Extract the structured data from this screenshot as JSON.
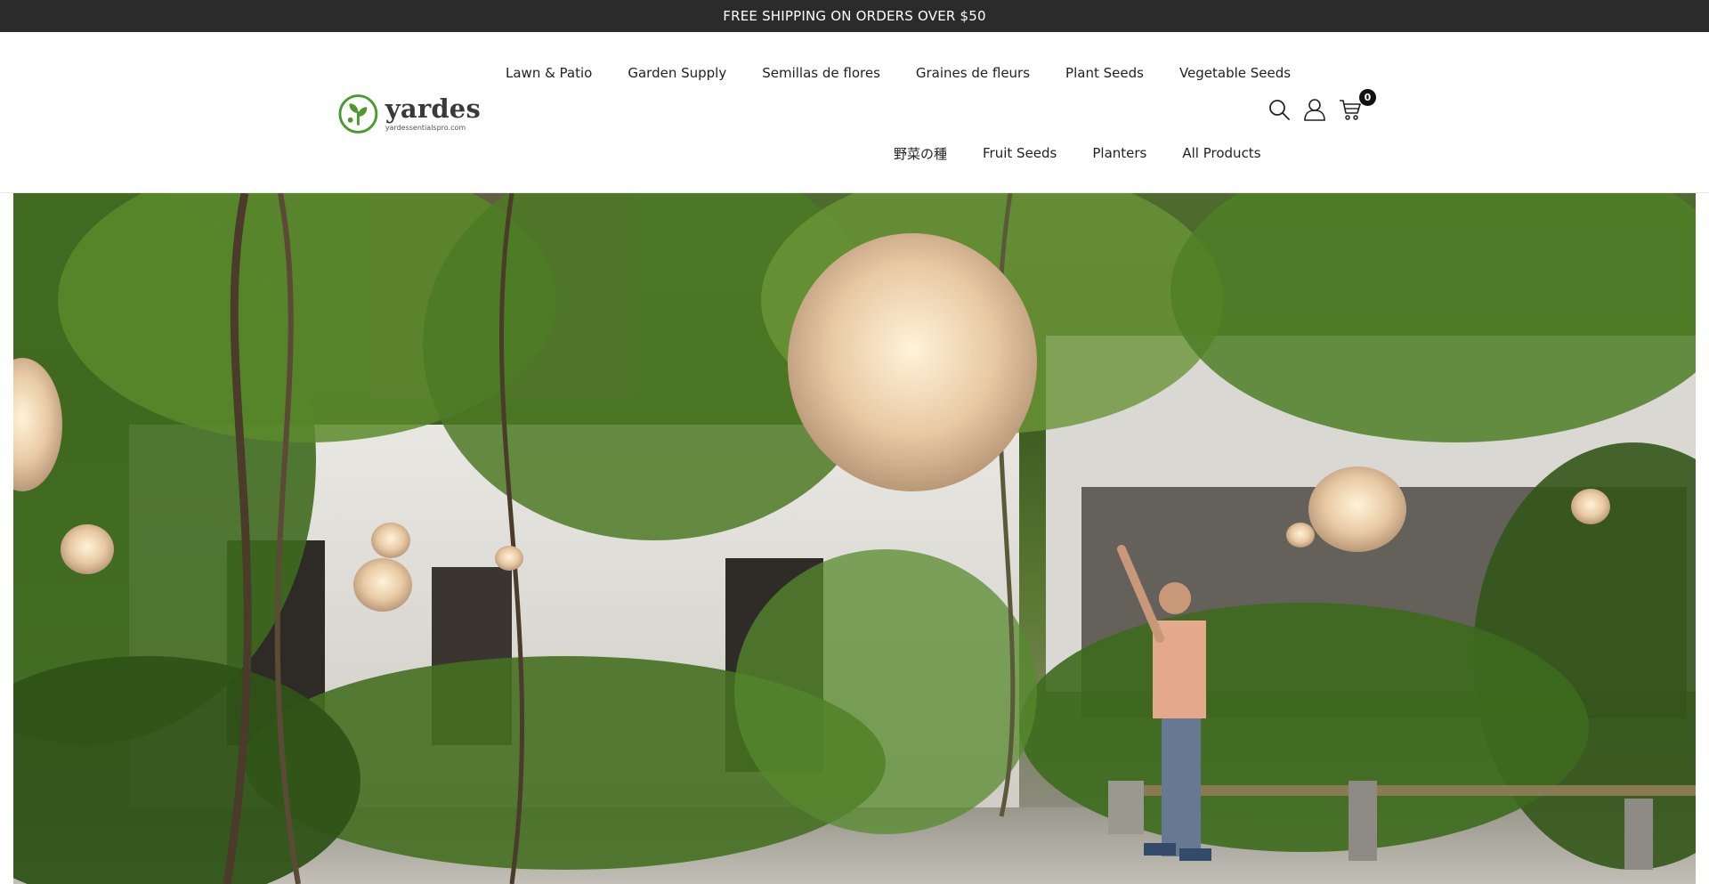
{
  "announcement": {
    "text": "FREE SHIPPING ON ORDERS OVER $50"
  },
  "logo": {
    "name": "yardes",
    "domain": "yardessentialspro.com"
  },
  "nav": {
    "top": [
      {
        "label": "Lawn & Patio"
      },
      {
        "label": "Garden Supply"
      },
      {
        "label": "Semillas de flores"
      },
      {
        "label": "Graines de fleurs"
      },
      {
        "label": "Plant Seeds"
      },
      {
        "label": "Vegetable Seeds"
      }
    ],
    "bottom": [
      {
        "label": "野菜の種"
      },
      {
        "label": "Fruit Seeds"
      },
      {
        "label": "Planters"
      },
      {
        "label": "All Products"
      }
    ]
  },
  "header_tools": {
    "search_icon": "search-icon",
    "account_icon": "user-icon",
    "cart_icon": "cart-icon",
    "cart_count": "0"
  },
  "colors": {
    "announcement_bg": "#2b2b2b",
    "logo_green": "#4a9a2e",
    "text": "#222222"
  }
}
